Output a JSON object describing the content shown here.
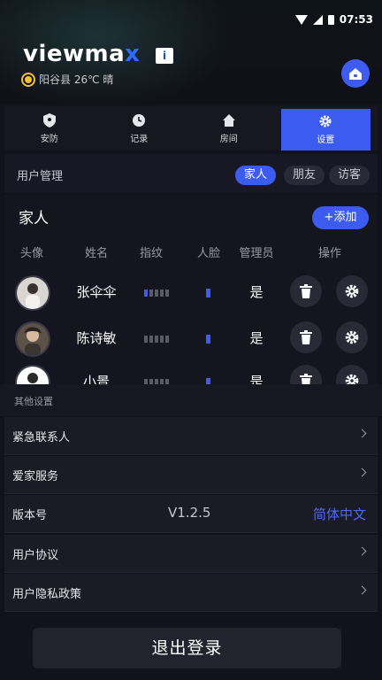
{
  "status": {
    "time": "07:53"
  },
  "header": {
    "brand_main": "viewma",
    "brand_x": "x",
    "brand_badge": "i",
    "weather": "阳谷县 26℃ 晴"
  },
  "tabs": [
    {
      "label": "安防",
      "icon": "shield-icon"
    },
    {
      "label": "记录",
      "icon": "clock-icon"
    },
    {
      "label": "房间",
      "icon": "home-icon"
    },
    {
      "label": "设置",
      "icon": "gear-icon",
      "active": true
    }
  ],
  "user_management": {
    "title": "用户管理",
    "filters": [
      {
        "label": "家人",
        "active": true
      },
      {
        "label": "朋友",
        "active": false
      },
      {
        "label": "访客",
        "active": false
      }
    ]
  },
  "members": {
    "group_title": "家人",
    "add_label": "+添加",
    "columns": [
      "头像",
      "姓名",
      "指纹",
      "人脸",
      "管理员",
      "操作"
    ],
    "rows": [
      {
        "name": "张伞伞",
        "admin": "是",
        "fingerprint_count": 1,
        "face_count": 1
      },
      {
        "name": "陈诗敏",
        "admin": "是",
        "fingerprint_count": 0,
        "face_count": 1
      },
      {
        "name": "小景",
        "admin": "是",
        "fingerprint_count": 0,
        "face_count": 1
      }
    ]
  },
  "other_settings": {
    "title": "其他设置",
    "items": [
      {
        "label": "紧急联系人"
      },
      {
        "label": "爱家服务"
      },
      {
        "label": "版本号",
        "value": "V1.2.5",
        "link": "简体中文"
      },
      {
        "label": "用户协议"
      },
      {
        "label": "用户隐私政策"
      }
    ]
  },
  "logout_label": "退出登录",
  "colors": {
    "accent": "#3c5cf0",
    "background": "#12121c"
  }
}
